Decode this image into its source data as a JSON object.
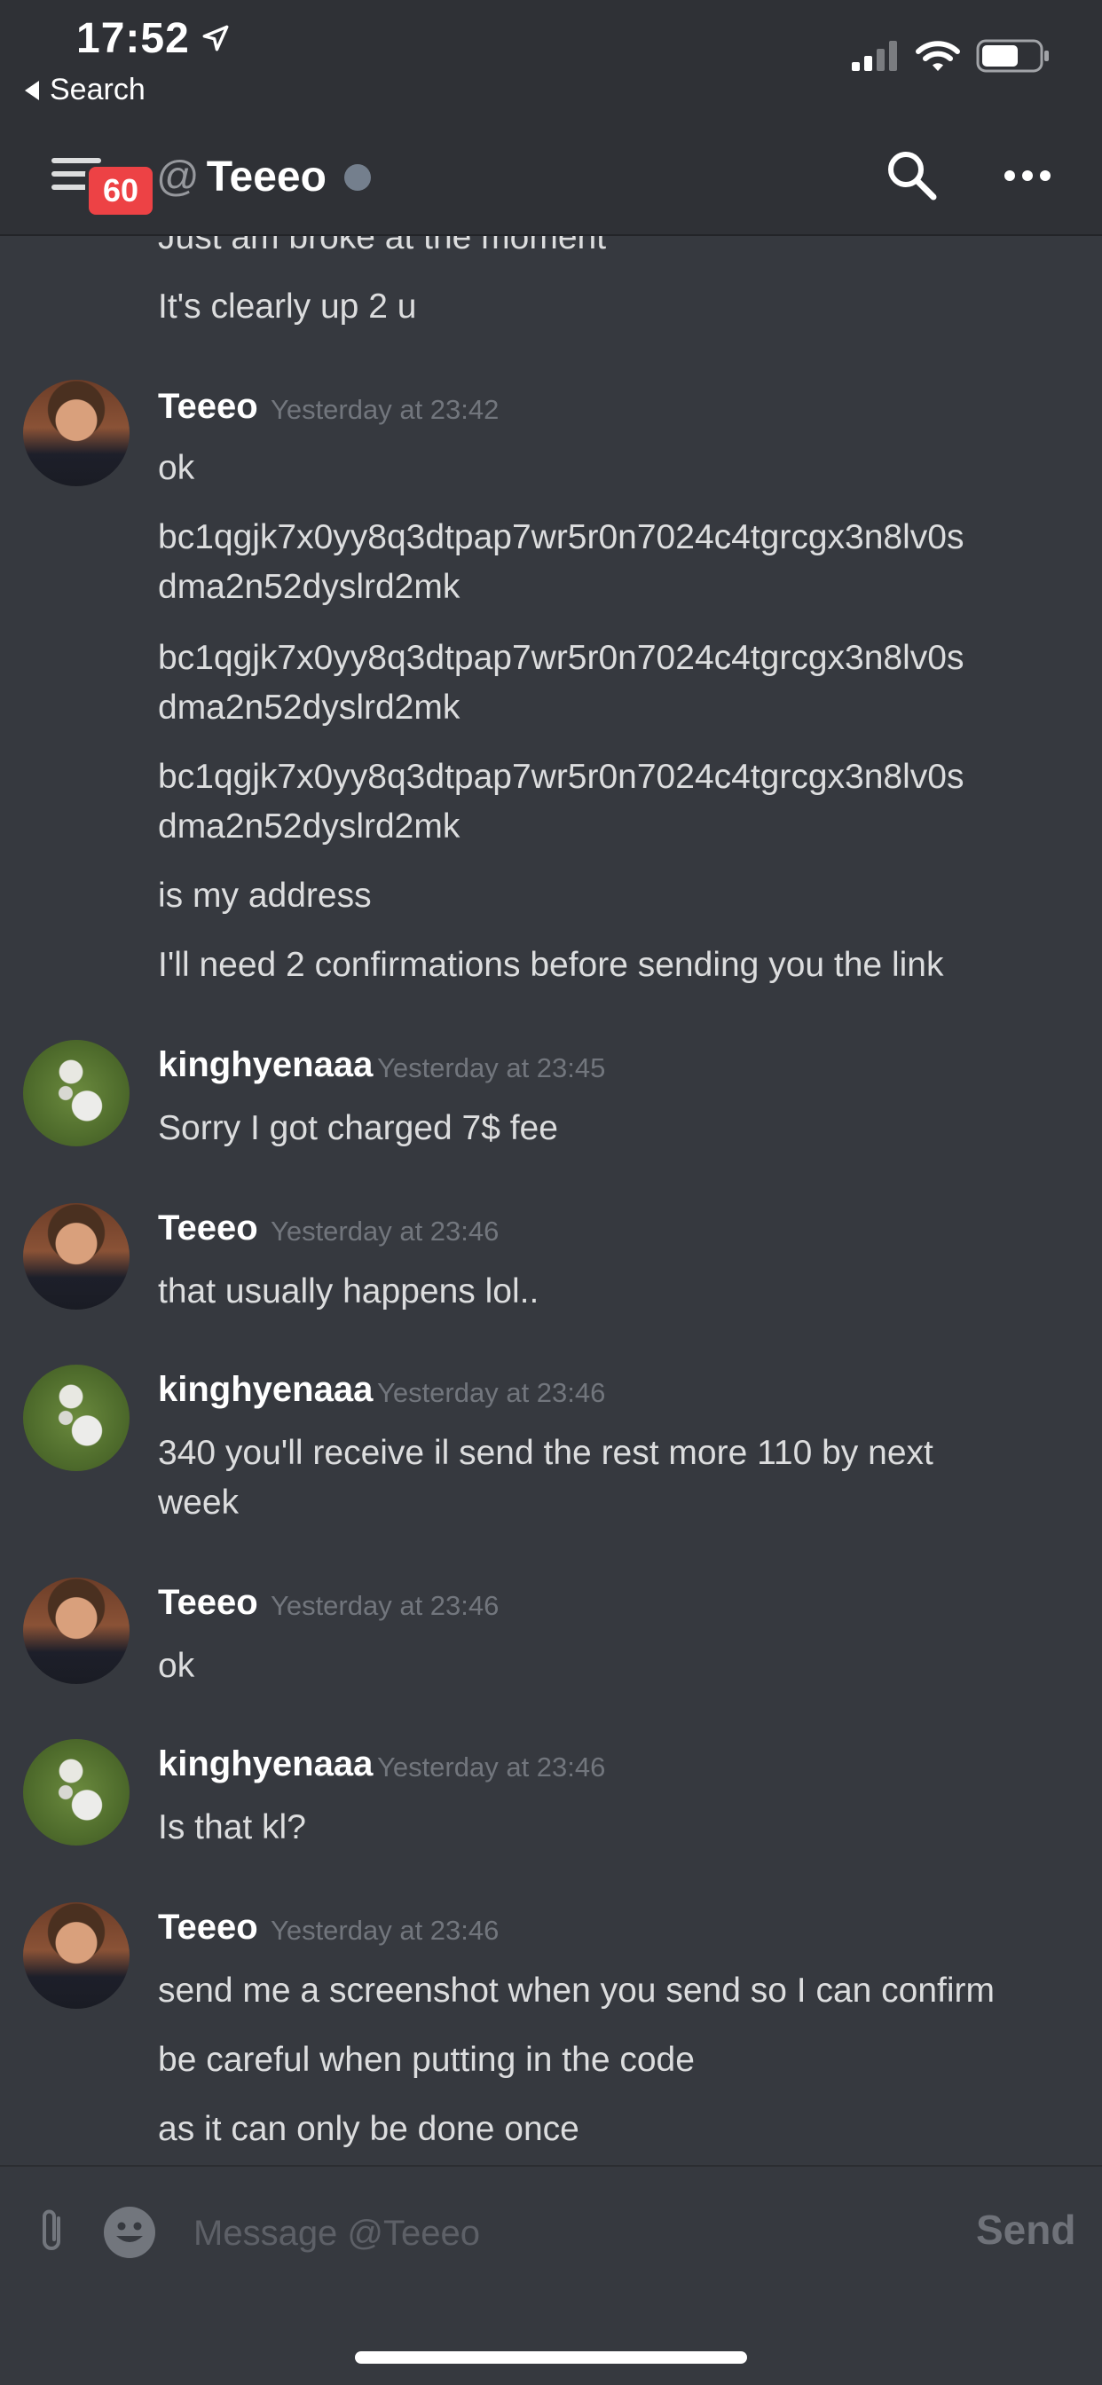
{
  "status_bar": {
    "time": "17:52",
    "back_label": "Search",
    "icons": [
      "location-arrow-icon",
      "cellular-signal-icon",
      "wifi-icon",
      "battery-icon"
    ]
  },
  "header": {
    "unread_badge": "60",
    "at_sign": "@",
    "channel_name": "Teeeo",
    "icons": [
      "hamburger-menu-icon",
      "status-dot-icon",
      "search-icon",
      "more-options-icon"
    ]
  },
  "messages": {
    "partial": {
      "line_0": "Just am broke at the moment",
      "line_1": "It's clearly up 2 u"
    },
    "g1": {
      "author": "Teeeo",
      "timestamp": "Yesterday at 23:42",
      "line_0": "ok",
      "line_1": "bc1qgjk7x0yy8q3dtpap7wr5r0n7024c4tgrcgx3n8lv0s",
      "line_2": "dma2n52dyslrd2mk",
      "line_3": "bc1qgjk7x0yy8q3dtpap7wr5r0n7024c4tgrcgx3n8lv0s",
      "line_4": "dma2n52dyslrd2mk",
      "line_5": "bc1qgjk7x0yy8q3dtpap7wr5r0n7024c4tgrcgx3n8lv0s",
      "line_6": "dma2n52dyslrd2mk",
      "line_7": "is my address",
      "line_8": "I'll need 2 confirmations before sending you the link"
    },
    "g2": {
      "author": "kinghyenaaa",
      "timestamp": "Yesterday at 23:45",
      "line_0": "Sorry I got charged 7$ fee"
    },
    "g3": {
      "author": "Teeeo",
      "timestamp": "Yesterday at 23:46",
      "line_0": "that usually happens lol.."
    },
    "g4": {
      "author": "kinghyenaaa",
      "timestamp": "Yesterday at 23:46",
      "line_0": "340 you'll receive il send the rest more 110 by next",
      "line_1": "week"
    },
    "g5": {
      "author": "Teeeo",
      "timestamp": "Yesterday at 23:46",
      "line_0": "ok"
    },
    "g6": {
      "author": "kinghyenaaa",
      "timestamp": "Yesterday at 23:46",
      "line_0": "Is that kl?"
    },
    "g7": {
      "author": "Teeeo",
      "timestamp": "Yesterday at 23:46",
      "line_0": "send me a screenshot when you send so I can confirm",
      "line_1": "be careful when putting in the code",
      "line_2": "as it can only be done once"
    }
  },
  "composer": {
    "placeholder": "Message @Teeeo",
    "value": "",
    "send_label": "Send",
    "icons": [
      "paperclip-icon",
      "emoji-icon"
    ]
  },
  "colors": {
    "background": "#36393f",
    "header_background": "#2f3136",
    "badge": "#ed4245",
    "timestamp": "#72767d",
    "text": "#dcddde"
  }
}
